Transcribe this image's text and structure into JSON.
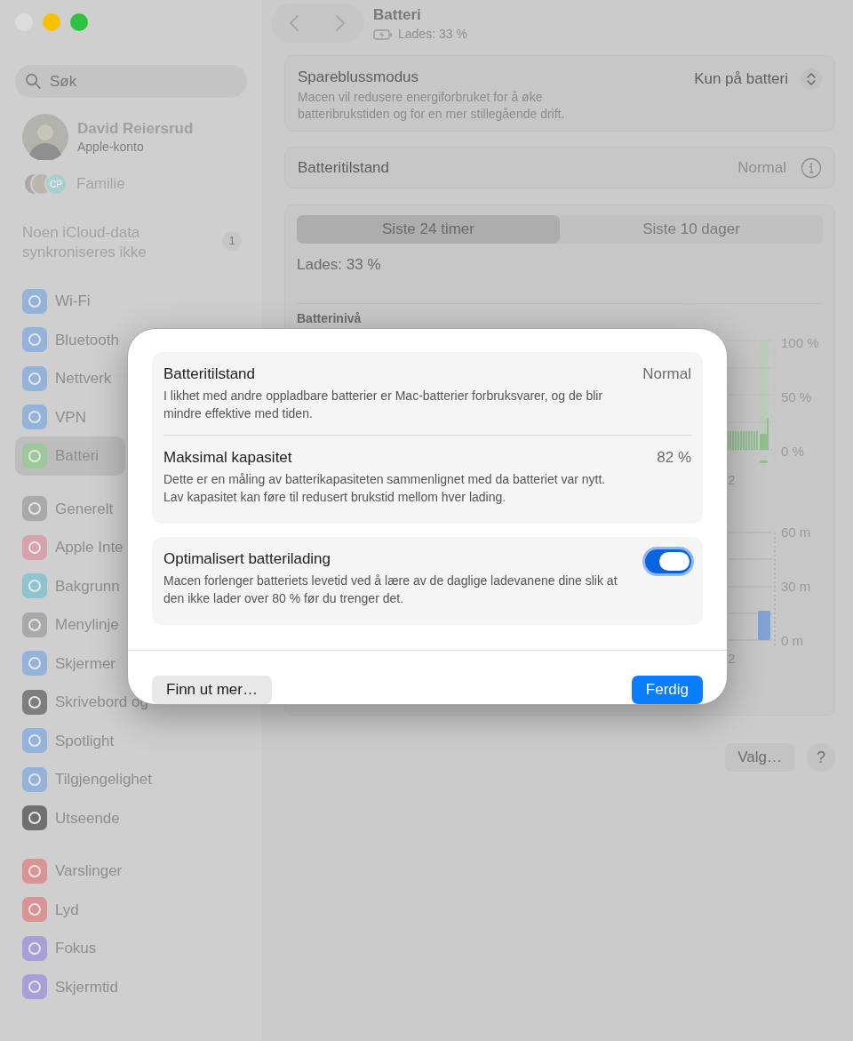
{
  "sidebar": {
    "search": {
      "placeholder": "Søk"
    },
    "account": {
      "name": "David Reiersrud",
      "subtitle": "Apple-konto"
    },
    "family": {
      "label": "Familie",
      "initials": "CP"
    },
    "notice": {
      "text": "Noen iCloud-data synkroniseres ikke",
      "badge": "1"
    },
    "groups": [
      [
        {
          "label": "Wi-Fi",
          "color": "#93b3da",
          "selected": false
        },
        {
          "label": "Bluetooth",
          "color": "#93b3da",
          "selected": false
        },
        {
          "label": "Nettverk",
          "color": "#93b3da",
          "selected": false
        },
        {
          "label": "VPN",
          "color": "#93b3da",
          "selected": false
        },
        {
          "label": "Batteri",
          "color": "#9cc89c",
          "selected": true
        }
      ],
      [
        {
          "label": "Generelt",
          "color": "#a9a9a9",
          "selected": false
        },
        {
          "label": "Apple Inte",
          "color": "#d6a3ad",
          "selected": false
        },
        {
          "label": "Bakgrunn",
          "color": "#8ec4cf",
          "selected": false
        },
        {
          "label": "Menylinje",
          "color": "#a9a9a9",
          "selected": false
        },
        {
          "label": "Skjermer",
          "color": "#93b3da",
          "selected": false
        },
        {
          "label": "Skrivebord og",
          "color": "#7e7e7e",
          "selected": false
        },
        {
          "label": "Spotlight",
          "color": "#93b3da",
          "selected": false
        },
        {
          "label": "Tilgjengelighet",
          "color": "#93b3da",
          "selected": false
        },
        {
          "label": "Utseende",
          "color": "#6f6f6f",
          "selected": false
        }
      ],
      [
        {
          "label": "Varslinger",
          "color": "#d99393",
          "selected": false
        },
        {
          "label": "Lyd",
          "color": "#d99393",
          "selected": false
        },
        {
          "label": "Fokus",
          "color": "#a89fd8",
          "selected": false
        },
        {
          "label": "Skjermtid",
          "color": "#a89fd8",
          "selected": false
        }
      ]
    ]
  },
  "toolbar": {
    "title": "Batteri",
    "subtitle": "Lades: 33 %"
  },
  "low_power_mode": {
    "title": "Spareblussmodus",
    "description": "Macen vil redusere energiforbruket for å øke batteribrukstiden og for en mer stillegående drift.",
    "value": "Kun på batteri"
  },
  "battery_health": {
    "label": "Batteritilstand",
    "value": "Normal"
  },
  "history": {
    "tabs": [
      {
        "label": "Siste 24 timer",
        "selected": true
      },
      {
        "label": "Siste 10 dager",
        "selected": false
      }
    ],
    "status": "Lades: 33 %",
    "battery_level": {
      "title": "Batterinivå",
      "yticks": [
        "100 %",
        "50 %",
        "0 %"
      ],
      "x_label": "2"
    },
    "screen_time": {
      "yticks": [
        "60 m",
        "30 m",
        "0 m"
      ],
      "x_label": "2"
    }
  },
  "footer": {
    "options_button": "Valg…",
    "help_button": "?"
  },
  "dialog": {
    "sections": [
      {
        "rows": [
          {
            "kind": "value",
            "title": "Batteritilstand",
            "value": "Normal",
            "description": "I likhet med andre oppladbare batterier er Mac-batterier forbruksvarer, og de blir mindre effektive med tiden."
          },
          {
            "kind": "value",
            "title": "Maksimal kapasitet",
            "value": "82 %",
            "description": "Dette er en måling av batterikapasiteten sammenlignet med da batteriet var nytt. Lav kapasitet kan føre til redusert brukstid mellom hver lading."
          }
        ]
      },
      {
        "rows": [
          {
            "kind": "toggle",
            "title": "Optimalisert batterilading",
            "on": true,
            "description": "Macen forlenger batteriets levetid ved å lære av de daglige ladevanene dine slik at den ikke lader over 80 % før du trenger det."
          }
        ]
      }
    ],
    "buttons": [
      {
        "label": "Finn ut mer…",
        "kind": "secondary"
      },
      {
        "label": "Ferdig",
        "kind": "primary"
      }
    ]
  }
}
